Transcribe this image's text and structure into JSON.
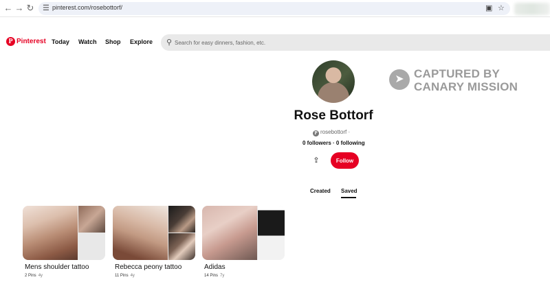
{
  "browser": {
    "url": "pinterest.com/rosebottorf/"
  },
  "header": {
    "logo": "Pinterest",
    "nav": [
      "Today",
      "Watch",
      "Shop",
      "Explore"
    ],
    "search_placeholder": "Search for easy dinners, fashion, etc."
  },
  "profile": {
    "name": "Rose Bottorf",
    "handle": "rosebottorf",
    "handle_suffix": "·",
    "follow_stats": "0 followers · 0 following",
    "follow_label": "Follow"
  },
  "watermark": {
    "line1": "CAPTURED BY",
    "line2": "CANARY MISSION"
  },
  "tabs": {
    "created": "Created",
    "saved": "Saved",
    "active": "saved"
  },
  "boards": [
    {
      "title": "Mens shoulder tattoo",
      "pins": "2 Pins",
      "age": "4y"
    },
    {
      "title": "Rebecca peony tattoo",
      "pins": "11 Pins",
      "age": "4y"
    },
    {
      "title": "Adidas",
      "pins": "14 Pins",
      "age": "7y"
    }
  ],
  "colors": {
    "brand": "#e60023",
    "watermark": "#9a9a9a"
  },
  "icons": {
    "back": "arrow-left-icon",
    "forward": "arrow-right-icon",
    "reload": "reload-icon",
    "search": "search-icon",
    "share": "share-icon"
  }
}
